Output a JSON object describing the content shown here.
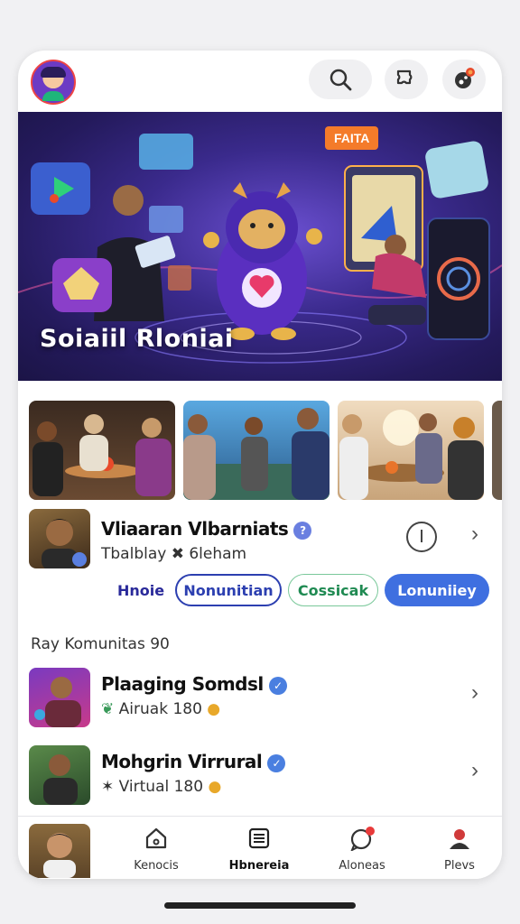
{
  "header": {
    "search_icon": "search-icon",
    "puzzle_icon": "puzzle-icon",
    "notification_icon": "bell-icon"
  },
  "hero": {
    "title": "Soiaiil Rloniai",
    "badge": "FAITA"
  },
  "featured": {
    "name": "Vliaaran Vlbarniats",
    "subtitle": "Tbalblay ✖ 6leham"
  },
  "tabs": [
    {
      "label": "Hnoie"
    },
    {
      "label": "Nonunitian"
    },
    {
      "label": "Cossicak"
    },
    {
      "label": "Lonuniiey"
    }
  ],
  "section": {
    "title": "Ray Komunitas 90"
  },
  "groups": [
    {
      "name": "Plaaging Somdsl",
      "subtitle": "Airuak 180"
    },
    {
      "name": "Mohgrin Virrural",
      "subtitle": "Virtual 180"
    }
  ],
  "nav": [
    {
      "label": "Kenocis"
    },
    {
      "label": "Hbnereia"
    },
    {
      "label": "Aloneas"
    },
    {
      "label": "Plevs"
    }
  ],
  "colors": {
    "accent": "#3f6fe0",
    "tab_border": "#2c3fb0",
    "tab_green": "#1f8a52",
    "notification": "#e84a2a"
  }
}
